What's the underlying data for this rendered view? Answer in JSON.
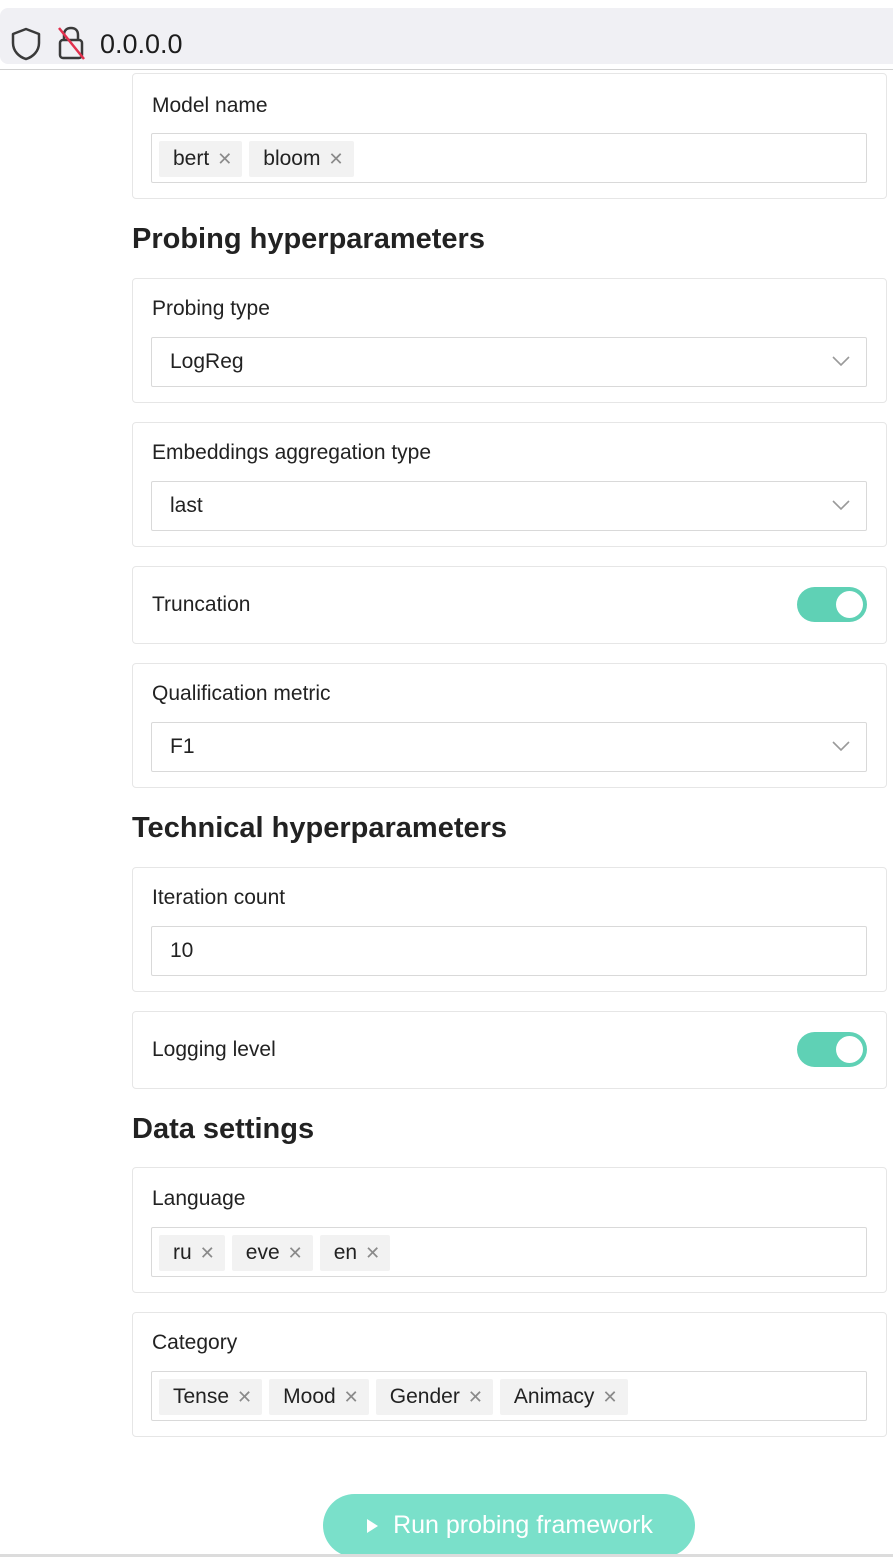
{
  "browser": {
    "url": "0.0.0.0",
    "shield_icon": "shield-icon",
    "lock_icon": "lock-insecure-icon"
  },
  "model_name": {
    "label": "Model name",
    "tags": [
      "bert",
      "bloom"
    ]
  },
  "probing_section": {
    "title": "Probing hyperparameters",
    "probing_type": {
      "label": "Probing type",
      "value": "LogReg"
    },
    "aggregation": {
      "label": "Embeddings aggregation type",
      "value": "last"
    },
    "truncation": {
      "label": "Truncation",
      "on": true
    },
    "metric": {
      "label": "Qualification metric",
      "value": "F1"
    }
  },
  "technical_section": {
    "title": "Technical hyperparameters",
    "iteration_count": {
      "label": "Iteration count",
      "value": "10"
    },
    "logging_level": {
      "label": "Logging level",
      "on": true
    }
  },
  "data_section": {
    "title": "Data settings",
    "language": {
      "label": "Language",
      "tags": [
        "ru",
        "eve",
        "en"
      ]
    },
    "category": {
      "label": "Category",
      "tags": [
        "Tense",
        "Mood",
        "Gender",
        "Animacy"
      ]
    }
  },
  "run_button": {
    "label": "Run probing framework"
  },
  "colors": {
    "accent": "#5fd1b5",
    "button": "#7ae0ca"
  }
}
